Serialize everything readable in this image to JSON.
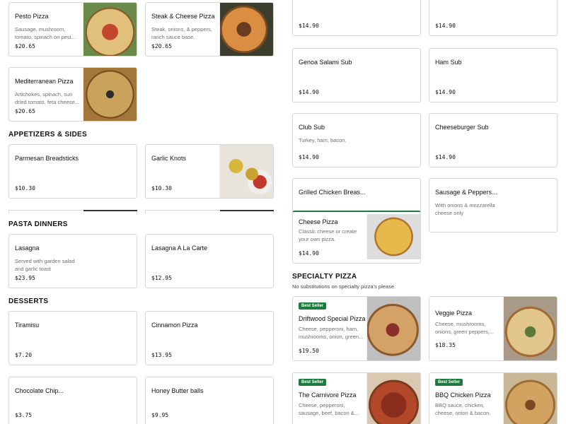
{
  "sections": {
    "appetizers": "APPETIZERS & SIDES",
    "pasta": "PASTA DINNERS",
    "desserts": "DESSERTS",
    "specialty": "SPECIALTY PIZZA",
    "specialty_note": "No substitutions on specialty pizza's please."
  },
  "badge": "Best Seller",
  "left": {
    "pesto": {
      "name": "Pesto Pizza",
      "desc1": "Sausage, mushroom,",
      "desc2": "tomato, spinach on pest...",
      "price": "$20.65"
    },
    "steak": {
      "name": "Steak & Cheese Pizza",
      "desc1": "Steak, onions, & peppers,",
      "desc2": "ranch sauce base.",
      "price": "$20.65"
    },
    "med": {
      "name": "Mediterranean Pizza",
      "desc1": "Artichokes, spinach, sun",
      "desc2": "dried tomato, feta cheese...",
      "price": "$20.65"
    },
    "bread": {
      "name": "Parmesan Breadsticks",
      "price": "$10.30"
    },
    "knots": {
      "name": "Garlic Knots",
      "price": "$10.30"
    },
    "lasagna": {
      "name": "Lasagna",
      "desc1": "Served with garden salad",
      "desc2": "and garlic toast",
      "price": "$23.95"
    },
    "lasagna_alc": {
      "name": "Lasagna A La Carte",
      "price": "$12.95"
    },
    "tiramisu": {
      "name": "Tiramisu",
      "price": "$7.20"
    },
    "cinnamon": {
      "name": "Cinnamon Pizza",
      "price": "$13.95"
    },
    "chocchip": {
      "name": "Chocolate Chip...",
      "price": "$3.75"
    },
    "honey": {
      "name": "Honey Butter balls",
      "price": "$9.95"
    }
  },
  "right": {
    "top1": {
      "price": "$14.90"
    },
    "top2": {
      "price": "$14.90"
    },
    "genoa": {
      "name": "Genoa Salami Sub",
      "price": "$14.90"
    },
    "ham": {
      "name": "Ham Sub",
      "price": "$14.90"
    },
    "club": {
      "name": "Club Sub",
      "desc1": "Turkey, ham, bacon.",
      "price": "$14.90"
    },
    "cheeseburger": {
      "name": "Cheeseburger Sub",
      "price": "$14.90"
    },
    "grilled": {
      "name": "Grilled Chicken Breas..."
    },
    "sausage": {
      "name": "Sausage & Peppers...",
      "desc1": "With onions & mozzarella",
      "desc2": "cheese only"
    },
    "cheesepizza": {
      "name": "Cheese Pizza",
      "desc1": "Classic cheese or create",
      "desc2": "your own pizza.",
      "price": "$14.90"
    },
    "driftwood": {
      "name": "Driftwood Special Pizza",
      "desc1": "Cheese, pepperoni, ham,",
      "desc2": "mushrooms, onion, green...",
      "price": "$19.50"
    },
    "veggie": {
      "name": "Veggie Pizza",
      "desc1": "Cheese, mushrooms,",
      "desc2": "onions, green peppers,...",
      "price": "$18.35"
    },
    "carnivore": {
      "name": "The Carnivore Pizza",
      "desc1": "Cheese, pepperoni,",
      "desc2": "sausage, beef, bacon &..."
    },
    "bbq": {
      "name": "BBQ Chicken Pizza",
      "desc1": "BBQ sauce, chicken,",
      "desc2": "cheese, onion & bacon."
    }
  },
  "colors": {
    "badge_green": "#1f7a3d",
    "border": "#d6d6d6",
    "text_muted": "#6f6f6f"
  }
}
